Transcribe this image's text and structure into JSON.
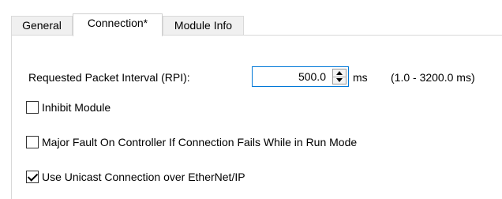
{
  "tabs": [
    {
      "label": "General",
      "active": false
    },
    {
      "label": "Connection*",
      "active": true
    },
    {
      "label": "Module Info",
      "active": false
    }
  ],
  "rpi": {
    "label": "Requested Packet Interval (RPI):",
    "value": "500.0",
    "unit": "ms",
    "range": "(1.0 - 3200.0 ms)"
  },
  "options": [
    {
      "label": "Inhibit Module",
      "checked": false
    },
    {
      "label": "Major Fault On Controller If Connection Fails While in Run Mode",
      "checked": false
    },
    {
      "label": "Use Unicast Connection over EtherNet/IP",
      "checked": true
    }
  ],
  "colors": {
    "focus_border": "#0078d7",
    "tab_inactive_bg": "#f0f0f0",
    "tab_border": "#d9d9d9"
  },
  "icons": [
    "spin-up-icon",
    "spin-down-icon",
    "checkmark-icon"
  ]
}
